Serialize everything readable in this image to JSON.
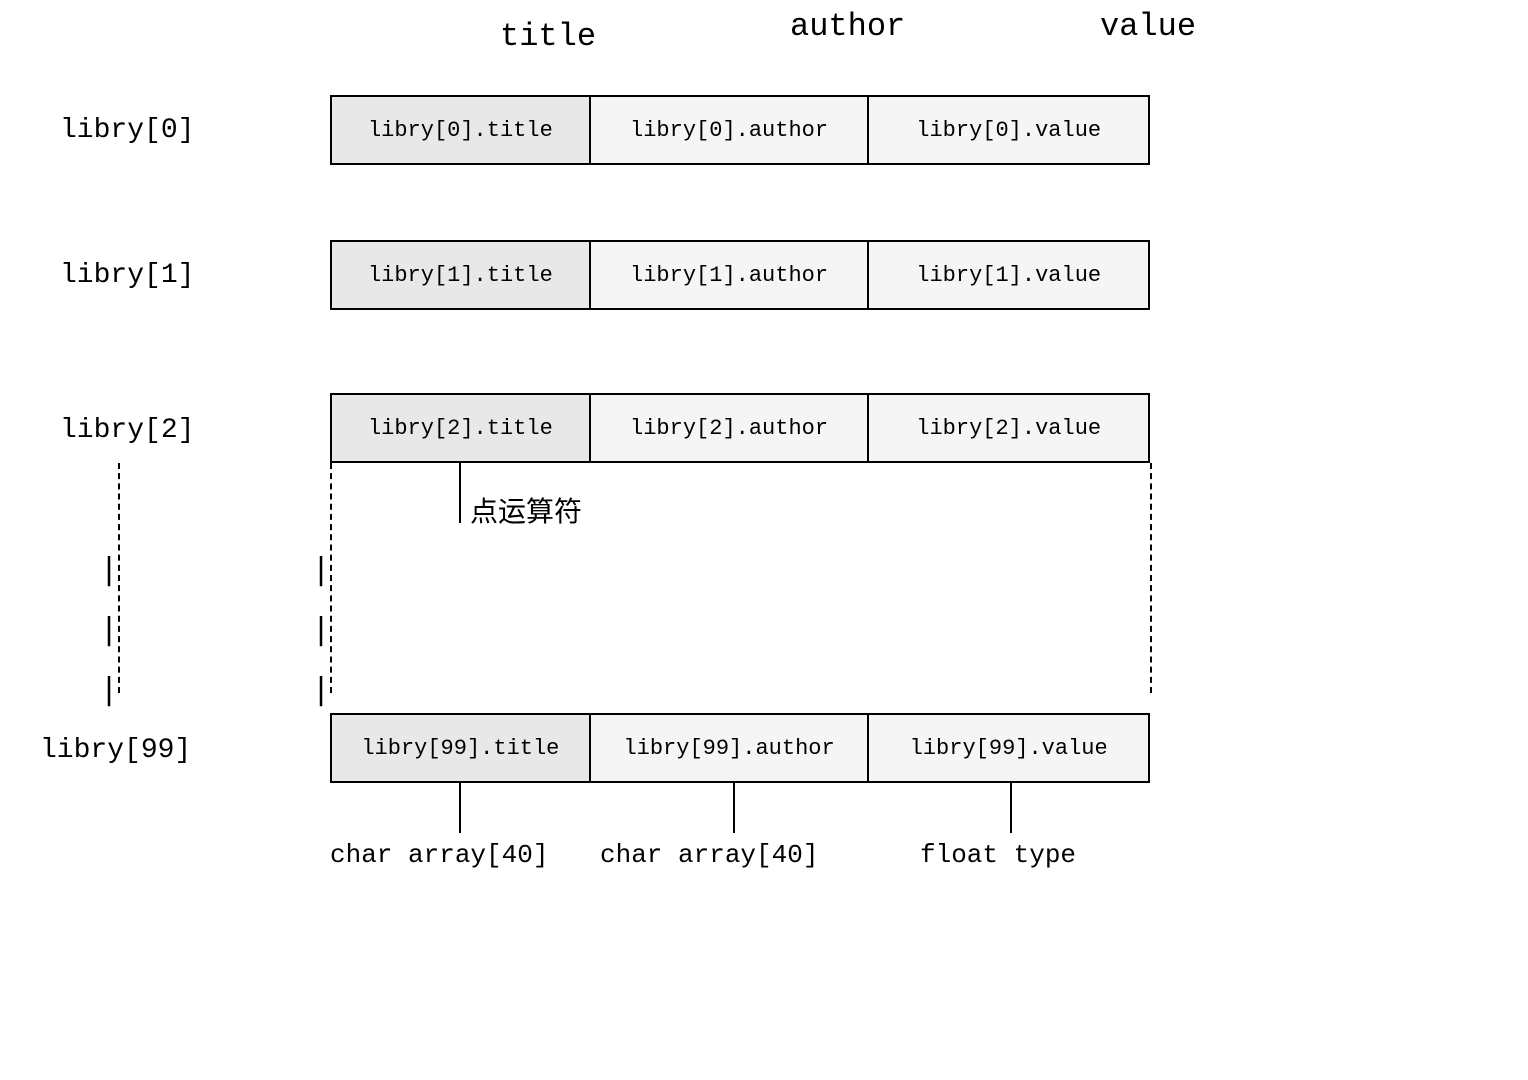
{
  "columns": {
    "title": "title",
    "author": "author",
    "value": "value"
  },
  "rows": [
    {
      "index": 0,
      "label": "libry[0]",
      "cells": {
        "title": "libry[0].title",
        "author": "libry[0].author",
        "value": "libry[0].value"
      }
    },
    {
      "index": 1,
      "label": "libry[1]",
      "cells": {
        "title": "libry[1].title",
        "author": "libry[1].author",
        "value": "libry[1].value"
      }
    },
    {
      "index": 2,
      "label": "libry[2]",
      "cells": {
        "title": "libry[2].title",
        "author": "libry[2].author",
        "value": "libry[2].value"
      }
    },
    {
      "index": 99,
      "label": "libry[99]",
      "cells": {
        "title": "libry[99].title",
        "author": "libry[99].author",
        "value": "libry[99].value"
      }
    }
  ],
  "annotation": "点运算符",
  "footer": {
    "char_array1": "char array[40]",
    "char_array2": "char array[40]",
    "float_type": "float type"
  }
}
